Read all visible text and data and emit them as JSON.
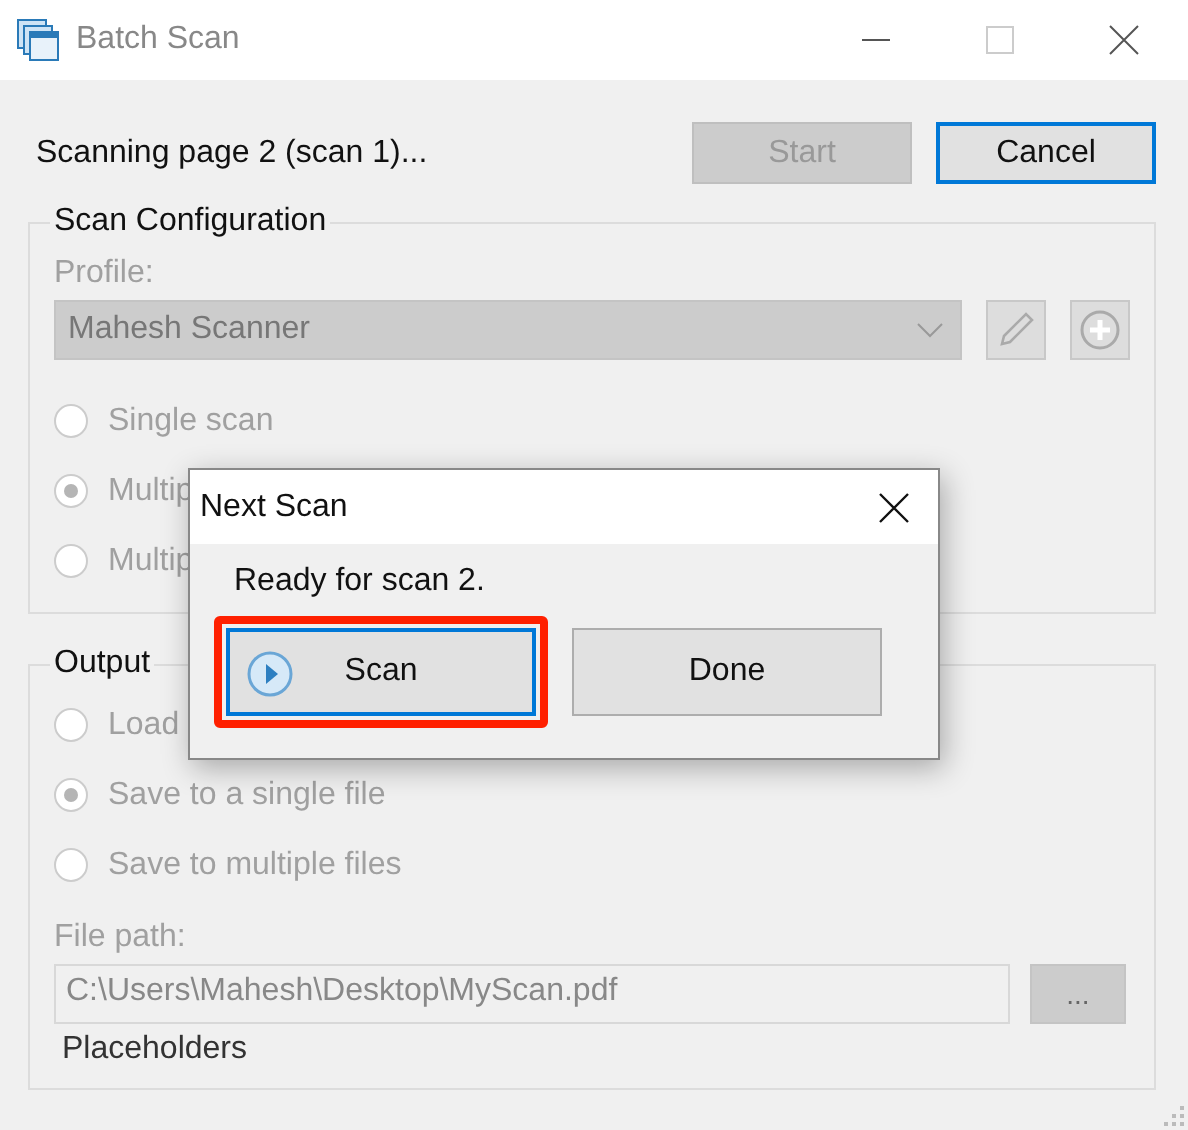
{
  "window": {
    "title": "Batch Scan"
  },
  "status": "Scanning page 2 (scan 1)...",
  "buttons": [
    {
      "label": "Start",
      "disabled": true,
      "default": false
    },
    {
      "label": "Cancel",
      "disabled": false,
      "default": true
    }
  ],
  "scan_configuration": {
    "title": "Scan Configuration",
    "disabled": true,
    "profile_label": "Profile:",
    "profile_value": "Mahesh Scanner",
    "options": [
      {
        "label": "Single scan",
        "selected": false
      },
      {
        "label": "Multip",
        "selected": true
      },
      {
        "label": "Multip",
        "selected": false
      }
    ]
  },
  "output": {
    "title": "Output",
    "disabled": true,
    "options": [
      {
        "label": "Load",
        "selected": false
      },
      {
        "label": "Save to a single file",
        "selected": true
      },
      {
        "label": "Save to multiple files",
        "selected": false
      }
    ],
    "file_path_label": "File path:",
    "file_path": "C:\\Users\\Mahesh\\Desktop\\MyScan.pdf",
    "browse": "...",
    "placeholders": "Placeholders"
  },
  "dialog": {
    "title": "Next Scan",
    "message": "Ready for scan 2.",
    "buttons": [
      {
        "kind": "scan",
        "label": "Scan",
        "highlighted": true
      },
      {
        "kind": "plain",
        "label": "Done",
        "highlighted": false
      }
    ]
  }
}
